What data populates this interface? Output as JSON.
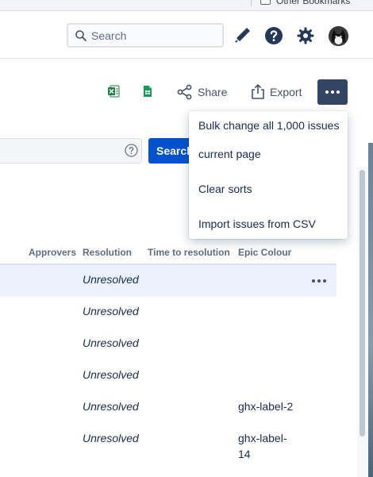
{
  "browser": {
    "bookmark_label": "Other Bookmarks"
  },
  "nav": {
    "search_placeholder": "Search",
    "icons": [
      "search-icon",
      "megaphone-icon",
      "help-icon",
      "gear-icon",
      "avatar"
    ]
  },
  "toolbar": {
    "share_label": "Share",
    "export_label": "Export"
  },
  "jql": {
    "search_button_label": "Search"
  },
  "menu": {
    "items": [
      "Bulk change all 1,000 issues",
      "current page",
      "Clear sorts",
      "Import issues from CSV"
    ]
  },
  "table": {
    "headers": {
      "approvers": "Approvers",
      "resolution": "Resolution",
      "time_to_resolution": "Time to resolution",
      "epic_colour": "Epic Colour"
    },
    "rows": [
      {
        "resolution": "Unresolved",
        "epic_colour": ""
      },
      {
        "resolution": "Unresolved",
        "epic_colour": ""
      },
      {
        "resolution": "Unresolved",
        "epic_colour": ""
      },
      {
        "resolution": "Unresolved",
        "epic_colour": ""
      },
      {
        "resolution": "Unresolved",
        "epic_colour": "ghx-label-2"
      },
      {
        "resolution": "Unresolved",
        "epic_colour": "ghx-label-14"
      }
    ]
  },
  "colors": {
    "primary": "#0052cc",
    "more_button": "#344563",
    "row_highlight": "#ebf2fd"
  }
}
